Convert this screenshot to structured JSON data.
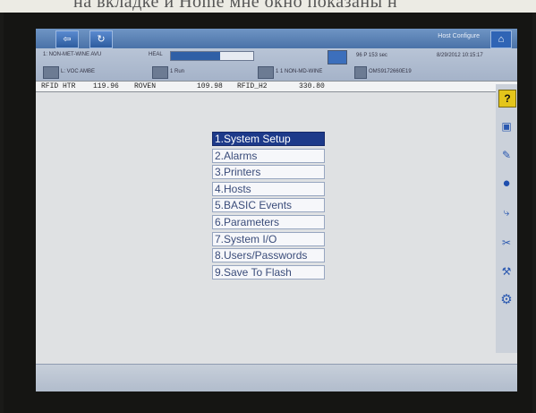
{
  "caption": "на вкладке и Home мне окно показаны н",
  "titlebar": {
    "back_icon": "back-arrow-icon",
    "refresh_icon": "refresh-icon",
    "right_label": "Host Configure",
    "home_icon": "home-icon"
  },
  "status": {
    "row1_left": "1: NON-MET-WINE AVU",
    "row1_mid": "HEAL",
    "row1_right": "96  P 153 sec",
    "row1_time": "8/29/2012 10:15:17",
    "row2_left": "L: VOC AMBE",
    "row2_mid": "1 Run",
    "row2_item": "1 1  NON-MD-WINE",
    "row2_code": "OMS9172660E19",
    "progress_fraction": 0.6
  },
  "temps": {
    "t1_label": "RFID HTR",
    "t1_value": "119.96",
    "t2_label": "ROVEN",
    "t2_value": "109.98",
    "t3_label": "RFID_H2",
    "t3_value": "330.80"
  },
  "menu": {
    "items": [
      {
        "label": "1.System Setup",
        "selected": true
      },
      {
        "label": "2.Alarms",
        "selected": false
      },
      {
        "label": "3.Printers",
        "selected": false
      },
      {
        "label": "4.Hosts",
        "selected": false
      },
      {
        "label": "5.BASIC Events",
        "selected": false
      },
      {
        "label": "6.Parameters",
        "selected": false
      },
      {
        "label": "7.System I/O",
        "selected": false
      },
      {
        "label": "8.Users/Passwords",
        "selected": false
      },
      {
        "label": "9.Save To Flash",
        "selected": false
      }
    ]
  },
  "toolbar": {
    "help_glyph": "?",
    "icons": [
      "help-icon",
      "camera-icon",
      "pen-icon",
      "globe-icon",
      "hook-icon",
      "scissors-icon",
      "wrench-icon",
      "gear-icon"
    ]
  }
}
